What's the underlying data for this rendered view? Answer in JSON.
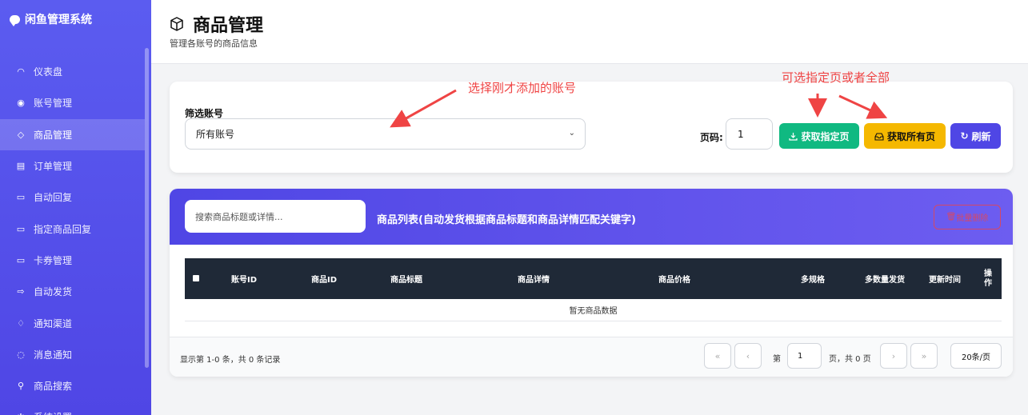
{
  "sidebar": {
    "brand": "闲鱼管理系统",
    "items": [
      {
        "label": "仪表盘",
        "icon": "dashboard-icon",
        "glyph": "◠",
        "active": false
      },
      {
        "label": "账号管理",
        "icon": "user-circle-icon",
        "glyph": "◉",
        "active": false
      },
      {
        "label": "商品管理",
        "icon": "box-icon",
        "glyph": "◇",
        "active": true
      },
      {
        "label": "订单管理",
        "icon": "receipt-icon",
        "glyph": "▤",
        "active": false
      },
      {
        "label": "自动回复",
        "icon": "chat-icon",
        "glyph": "▭",
        "active": false
      },
      {
        "label": "指定商品回复",
        "icon": "chat-square-icon",
        "glyph": "▭",
        "active": false
      },
      {
        "label": "卡券管理",
        "icon": "card-icon",
        "glyph": "▭",
        "active": false
      },
      {
        "label": "自动发货",
        "icon": "truck-icon",
        "glyph": "⇨",
        "active": false
      },
      {
        "label": "通知渠道",
        "icon": "bell-icon",
        "glyph": "♢",
        "active": false
      },
      {
        "label": "消息通知",
        "icon": "message-icon",
        "glyph": "◌",
        "active": false
      },
      {
        "label": "商品搜索",
        "icon": "search-icon",
        "glyph": "⚲",
        "active": false
      },
      {
        "label": "系统设置",
        "icon": "gear-icon",
        "glyph": "✲",
        "active": false
      }
    ]
  },
  "header": {
    "title": "商品管理",
    "subtitle": "管理各账号的商品信息"
  },
  "filter": {
    "label": "筛选账号",
    "selected": "所有账号",
    "page_label": "页码:",
    "page_value": "1",
    "btn_fetch_page": "获取指定页",
    "btn_fetch_all": "获取所有页",
    "btn_refresh": "刷新"
  },
  "list": {
    "search_placeholder": "搜索商品标题或详情...",
    "title": "商品列表(自动发货根据商品标题和商品详情匹配关键字)",
    "bulk_delete": "批量删除",
    "columns": [
      "账号ID",
      "商品ID",
      "商品标题",
      "商品详情",
      "商品价格",
      "多规格",
      "多数量发货",
      "更新时间",
      "操作"
    ],
    "empty": "暂无商品数据",
    "footer_info": "显示第 1-0 条，共 0 条记录",
    "page_prefix": "第",
    "page_input": "1",
    "page_suffix": "页，共 0 页",
    "per_page": "20条/页"
  },
  "annotations": {
    "select_account": "选择刚才添加的账号",
    "choose_page": "可选指定页或者全部",
    "color": "#ef4444"
  },
  "colors": {
    "primary": "#4f46e5",
    "green": "#10b981",
    "yellow": "#f5b800",
    "table_head": "#1f2937"
  }
}
